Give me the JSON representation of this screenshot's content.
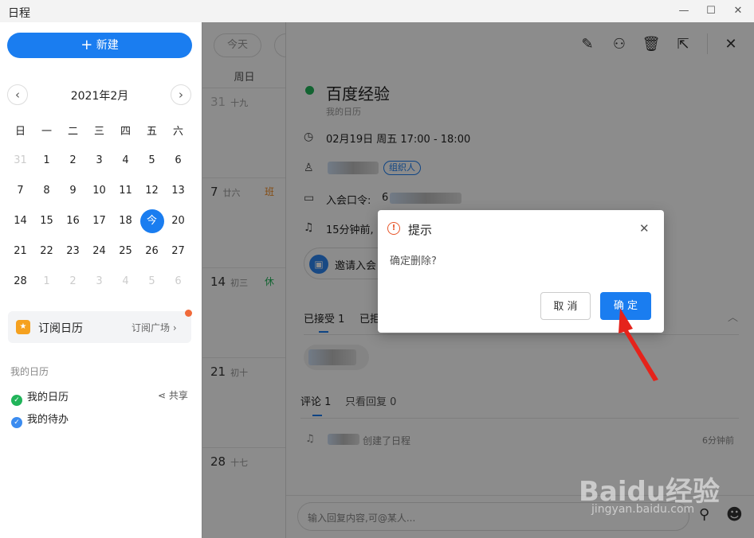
{
  "window": {
    "title": "日程"
  },
  "sidebar": {
    "new_button": "新建",
    "month_label": "2021年2月",
    "weekdays": [
      "日",
      "一",
      "二",
      "三",
      "四",
      "五",
      "六"
    ],
    "weeks": [
      [
        "31",
        "1",
        "2",
        "3",
        "4",
        "5",
        "6"
      ],
      [
        "7",
        "8",
        "9",
        "10",
        "11",
        "12",
        "13"
      ],
      [
        "14",
        "15",
        "16",
        "17",
        "18",
        "今",
        "20"
      ],
      [
        "21",
        "22",
        "23",
        "24",
        "25",
        "26",
        "27"
      ],
      [
        "28",
        "1",
        "2",
        "3",
        "4",
        "5",
        "6"
      ]
    ],
    "subscribe": {
      "label": "订阅日历",
      "link": "订阅广场"
    },
    "my_calendars_heading": "我的日历",
    "calendars": [
      {
        "name": "我的日历",
        "action": "共享",
        "color": "#21b45a"
      },
      {
        "name": "我的待办",
        "action": "",
        "color": "#3b8cf0"
      }
    ]
  },
  "dayview": {
    "today_button": "今天",
    "header": "周日",
    "rows": [
      {
        "day": "31",
        "lunar": "十九",
        "tag": ""
      },
      {
        "day": "7",
        "lunar": "廿六",
        "tag": "班"
      },
      {
        "day": "14",
        "lunar": "初三",
        "tag": "休"
      },
      {
        "day": "21",
        "lunar": "初十",
        "tag": ""
      },
      {
        "day": "28",
        "lunar": "十七",
        "tag": ""
      }
    ]
  },
  "event": {
    "title": "百度经验",
    "calendar": "我的日历",
    "time": "02月19日 周五 17:00 - 18:00",
    "organizer_badge": "组织人",
    "meeting_code_label": "入会口令:",
    "meeting_code_partial": "6",
    "reminder": "15分钟前,",
    "invite_button": "邀请入会",
    "tabs": {
      "accepted": "已接受 1",
      "declined_partial": "已拒"
    },
    "comment_tabs": {
      "comments": "评论 1",
      "replies_only": "只看回复 0"
    },
    "activity": {
      "text": "创建了日程",
      "time": "6分钟前"
    },
    "reply_placeholder": "输入回复内容,可@某人..."
  },
  "dialog": {
    "title": "提示",
    "message": "确定删除?",
    "cancel": "取 消",
    "confirm": "确 定"
  },
  "colors": {
    "accent": "#1a7df0",
    "event_dot": "#21b45a",
    "warning": "#e8562a"
  },
  "watermark": {
    "brand": "Baidu经验",
    "url": "jingyan.baidu.com"
  }
}
